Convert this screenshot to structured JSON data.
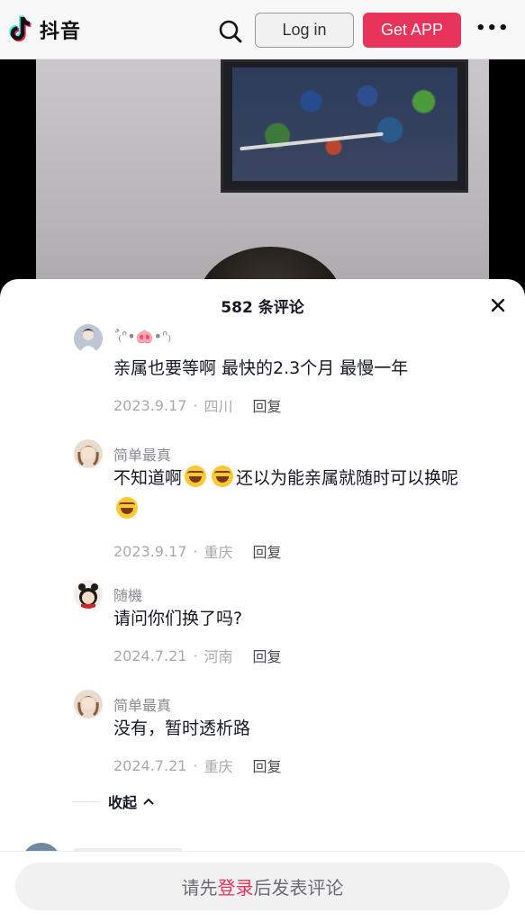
{
  "header": {
    "app_name": "抖音",
    "login_label": "Log in",
    "get_app_label": "Get APP",
    "more_label": "•••"
  },
  "comments_panel": {
    "title": "582 条评论",
    "comments": [
      {
        "user": "ٌ ₍ᐢ•🐽•ᐢ₎",
        "text": "亲属也要等啊 最快的2.3个月 最慢一年",
        "date": "2023.9.17",
        "location": "四川",
        "reply_label": "回复"
      },
      {
        "user": "简单最真",
        "text_parts": [
          "不知道啊",
          "还以为能亲属就随时可以换呢"
        ],
        "date": "2023.9.17",
        "location": "重庆",
        "reply_label": "回复"
      },
      {
        "user": "随機",
        "text": "请问你们换了吗?",
        "date": "2024.7.21",
        "location": "河南",
        "reply_label": "回复"
      },
      {
        "user": "简单最真",
        "text": "没有，暂时透析路",
        "date": "2024.7.21",
        "location": "重庆",
        "reply_label": "回复"
      }
    ],
    "collapse_label": "收起",
    "separator": "·"
  },
  "composer": {
    "prefix": "请先",
    "link": "登录",
    "suffix": "后发表评论"
  },
  "colors": {
    "accent": "#e8335a",
    "text_primary": "#161823",
    "text_secondary": "#a8a9ae"
  }
}
